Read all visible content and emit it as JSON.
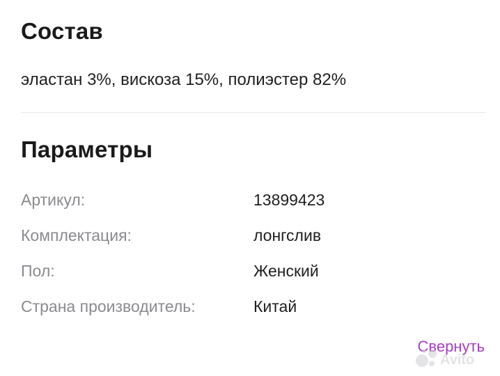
{
  "composition": {
    "title": "Состав",
    "text": "эластан 3%, вискоза 15%, полиэстер 82%"
  },
  "parameters": {
    "title": "Параметры",
    "rows": [
      {
        "label": "Артикул:",
        "value": "13899423"
      },
      {
        "label": "Комплектация:",
        "value": "лонгслив"
      },
      {
        "label": "Пол:",
        "value": "Женский"
      },
      {
        "label": "Страна производитель:",
        "value": "Китай"
      }
    ]
  },
  "actions": {
    "collapse_label": "Свернуть"
  },
  "watermark": {
    "logo_text": "Avito"
  },
  "colors": {
    "link": "#a43fc0",
    "label": "#8a8a8f",
    "text": "#1f1f1f"
  }
}
